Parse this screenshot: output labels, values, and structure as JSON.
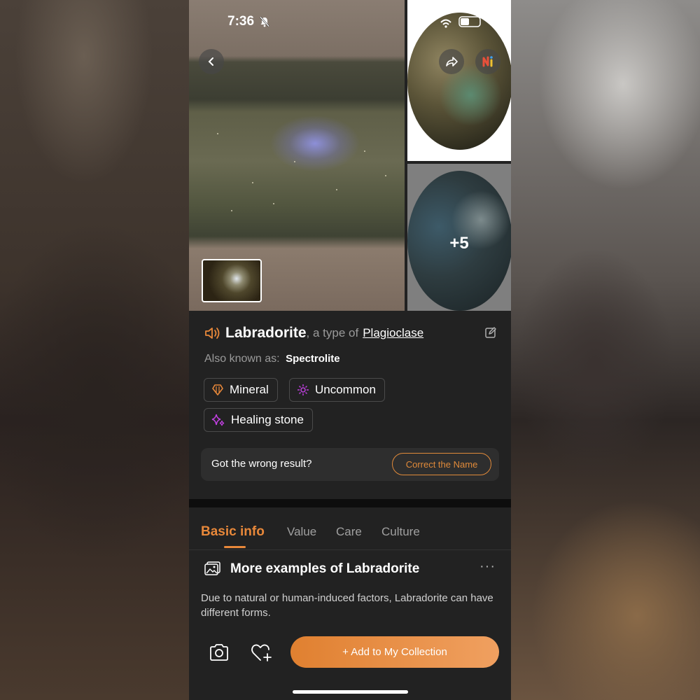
{
  "status": {
    "time": "7:36"
  },
  "hero": {
    "more_count": "+5"
  },
  "mineral": {
    "name": "Labradorite",
    "type_prefix": ", a type of",
    "parent_type": "Plagioclase",
    "aka_label": "Also known as:",
    "aka_value": "Spectrolite"
  },
  "tags": [
    {
      "label": "Mineral",
      "icon": "crystal-icon",
      "color": "#e8883a"
    },
    {
      "label": "Uncommon",
      "icon": "sparkle-icon",
      "color": "#c040e0"
    },
    {
      "label": "Healing stone",
      "icon": "stars-icon",
      "color": "#c040e0"
    }
  ],
  "feedback": {
    "question": "Got the wrong result?",
    "button": "Correct the Name"
  },
  "tabs": [
    "Basic info",
    "Value",
    "Care",
    "Culture"
  ],
  "section": {
    "title": "More examples of Labradorite",
    "description": "Due to natural or human-induced factors, Labradorite can have different forms."
  },
  "actions": {
    "add_label": "+ Add to My Collection"
  },
  "colors": {
    "accent": "#e8883a",
    "sheet_bg": "#222222"
  }
}
